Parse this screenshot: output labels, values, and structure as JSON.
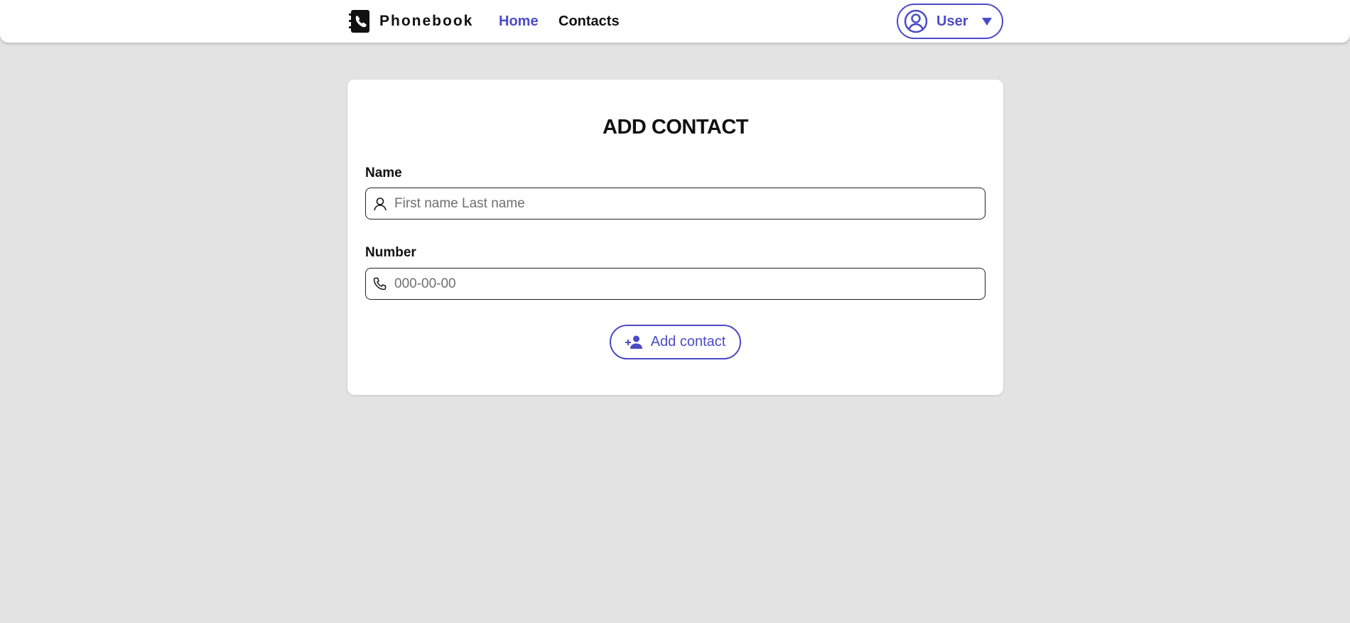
{
  "header": {
    "logo_text": "Phonebook",
    "nav": [
      {
        "label": "Home",
        "active": true
      },
      {
        "label": "Contacts",
        "active": false
      }
    ],
    "user_menu": {
      "label": "User",
      "icon": "user-circle-icon",
      "caret": "caret-down-icon"
    }
  },
  "form": {
    "title": "ADD CONTACT",
    "name": {
      "label": "Name",
      "value": "",
      "placeholder": "First name Last name",
      "icon": "person-icon"
    },
    "number": {
      "label": "Number",
      "value": "",
      "placeholder": "000-00-00",
      "icon": "phone-icon"
    },
    "submit_label": "Add contact",
    "submit_icon": "add-user-icon"
  },
  "colors": {
    "accent": "#4b4bc8",
    "background": "#e3e3e3",
    "card": "#ffffff",
    "text": "#111111"
  }
}
